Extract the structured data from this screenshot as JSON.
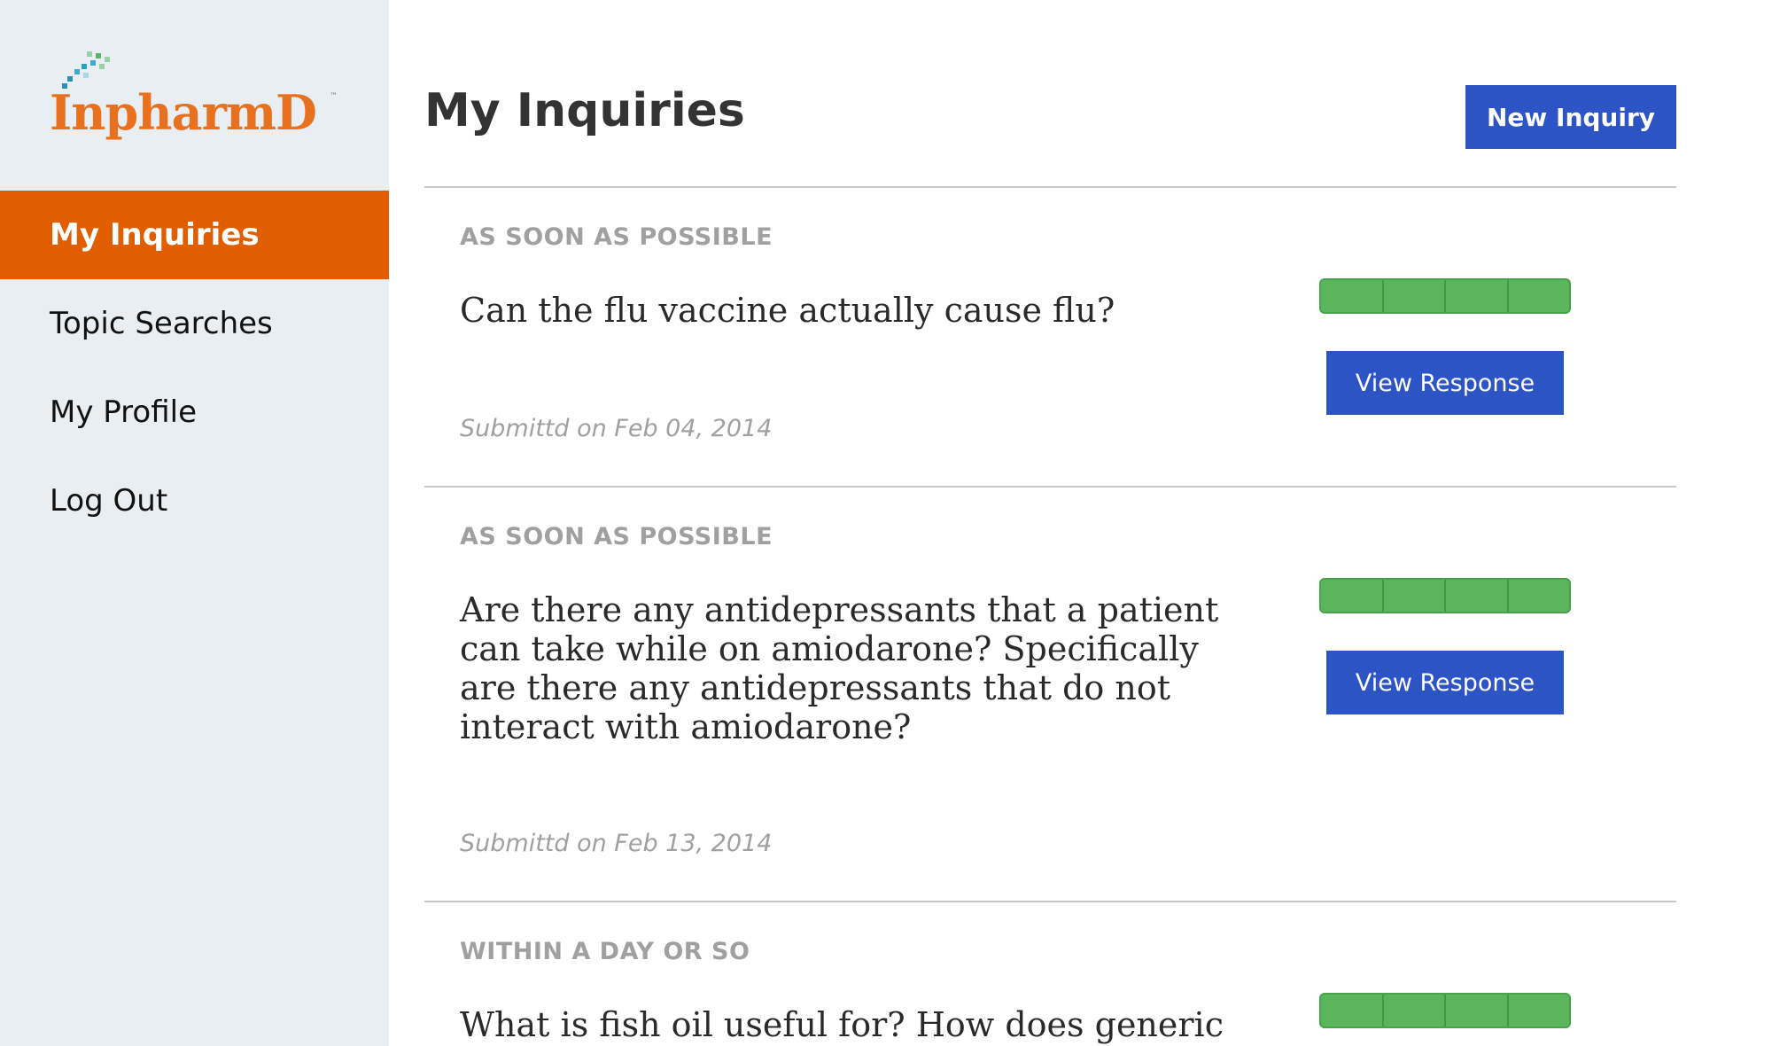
{
  "brand": {
    "logo_text": "InpharmD",
    "logo_tm": "™",
    "color_primary": "#e05e00",
    "color_button": "#2d54c5",
    "color_progress": "#5bb55d"
  },
  "sidebar": {
    "items": [
      {
        "label": "My Inquiries",
        "active": true
      },
      {
        "label": "Topic Searches",
        "active": false
      },
      {
        "label": "My Profile",
        "active": false
      },
      {
        "label": "Log Out",
        "active": false
      }
    ]
  },
  "header": {
    "title": "My Inquiries",
    "new_button": "New Inquiry"
  },
  "inquiries": [
    {
      "priority": "AS SOON AS POSSIBLE",
      "question": "Can the flu vaccine actually cause flu?",
      "submitted": "Submittd on Feb 04, 2014",
      "progress_segments_filled": 4,
      "progress_segments_total": 4,
      "action_label": "View Response"
    },
    {
      "priority": "AS SOON AS POSSIBLE",
      "question": "Are there any antidepressants that a patient can take while on amiodarone?  Specifically are there any antidepressants that do not interact with amiodarone?",
      "submitted": "Submittd on Feb 13, 2014",
      "progress_segments_filled": 4,
      "progress_segments_total": 4,
      "action_label": "View Response"
    },
    {
      "priority": "WITHIN A DAY OR SO",
      "question": "What is fish oil useful for? How does generic fish",
      "progress_segments_filled": 4,
      "progress_segments_total": 4
    }
  ]
}
